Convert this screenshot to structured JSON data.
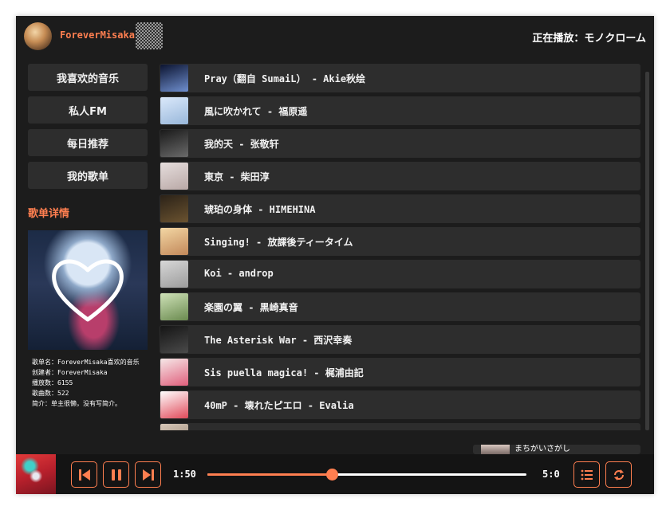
{
  "header": {
    "username": "ForeverMisaka",
    "now_playing": "正在播放：モノクローム"
  },
  "sidebar": {
    "nav": [
      {
        "label": "我喜欢的音乐"
      },
      {
        "label": "私人FM"
      },
      {
        "label": "每日推荐"
      },
      {
        "label": "我的歌单"
      }
    ],
    "section_title": "歌单详情",
    "info": {
      "name": "歌单名：ForeverMisaka喜欢的音乐",
      "creator": "创建者：ForeverMisaka",
      "plays": "播放数：6155",
      "count": "歌曲数：522",
      "intro": "简介：单主很懒，没有写简介。"
    }
  },
  "songs": [
    {
      "title": "Pray（翻自 SumaiL） - Akie秋绘",
      "thumb": [
        "#0c1430",
        "#6f8fcf"
      ]
    },
    {
      "title": "風に吹かれて - 福原遥",
      "thumb": [
        "#dbe9fb",
        "#98b7da"
      ]
    },
    {
      "title": "我的天 - 张敬轩",
      "thumb": [
        "#1a1a1a",
        "#6a6a6a"
      ]
    },
    {
      "title": "東京 - 柴田淳",
      "thumb": [
        "#e6dedd",
        "#b9a8a6"
      ]
    },
    {
      "title": "琥珀の身体 - HIMEHINA",
      "thumb": [
        "#2b2218",
        "#6b5330"
      ]
    },
    {
      "title": "Singing! - 放課後ティータイム",
      "thumb": [
        "#f3d7a4",
        "#c2885a"
      ]
    },
    {
      "title": "Koi - androp",
      "thumb": [
        "#d7d7d7",
        "#9c9c9c"
      ]
    },
    {
      "title": "楽園の翼 - 黒崎真音",
      "thumb": [
        "#cfe2b8",
        "#6a8a4f"
      ]
    },
    {
      "title": "The Asterisk War - 西沢幸奏",
      "thumb": [
        "#151515",
        "#4a4a4a"
      ]
    },
    {
      "title": "Sis puella magica! - 梶浦由記",
      "thumb": [
        "#f6e8e8",
        "#e05f7c"
      ]
    },
    {
      "title": "40mP - 壊れたピエロ - Evalia",
      "thumb": [
        "#ffffff",
        "#e04a5a"
      ]
    },
    {
      "title": "",
      "thumb": [
        "#d8c8b8",
        "#8a7a6a"
      ]
    }
  ],
  "mini_lyric": {
    "text": "まちがいさがし"
  },
  "player": {
    "current_time": "1:50",
    "total_time": "5:0",
    "progress": 0.39
  },
  "colors": {
    "accent": "#ff7f50",
    "background": "#1c1c1c",
    "item": "#2d2d2d"
  }
}
